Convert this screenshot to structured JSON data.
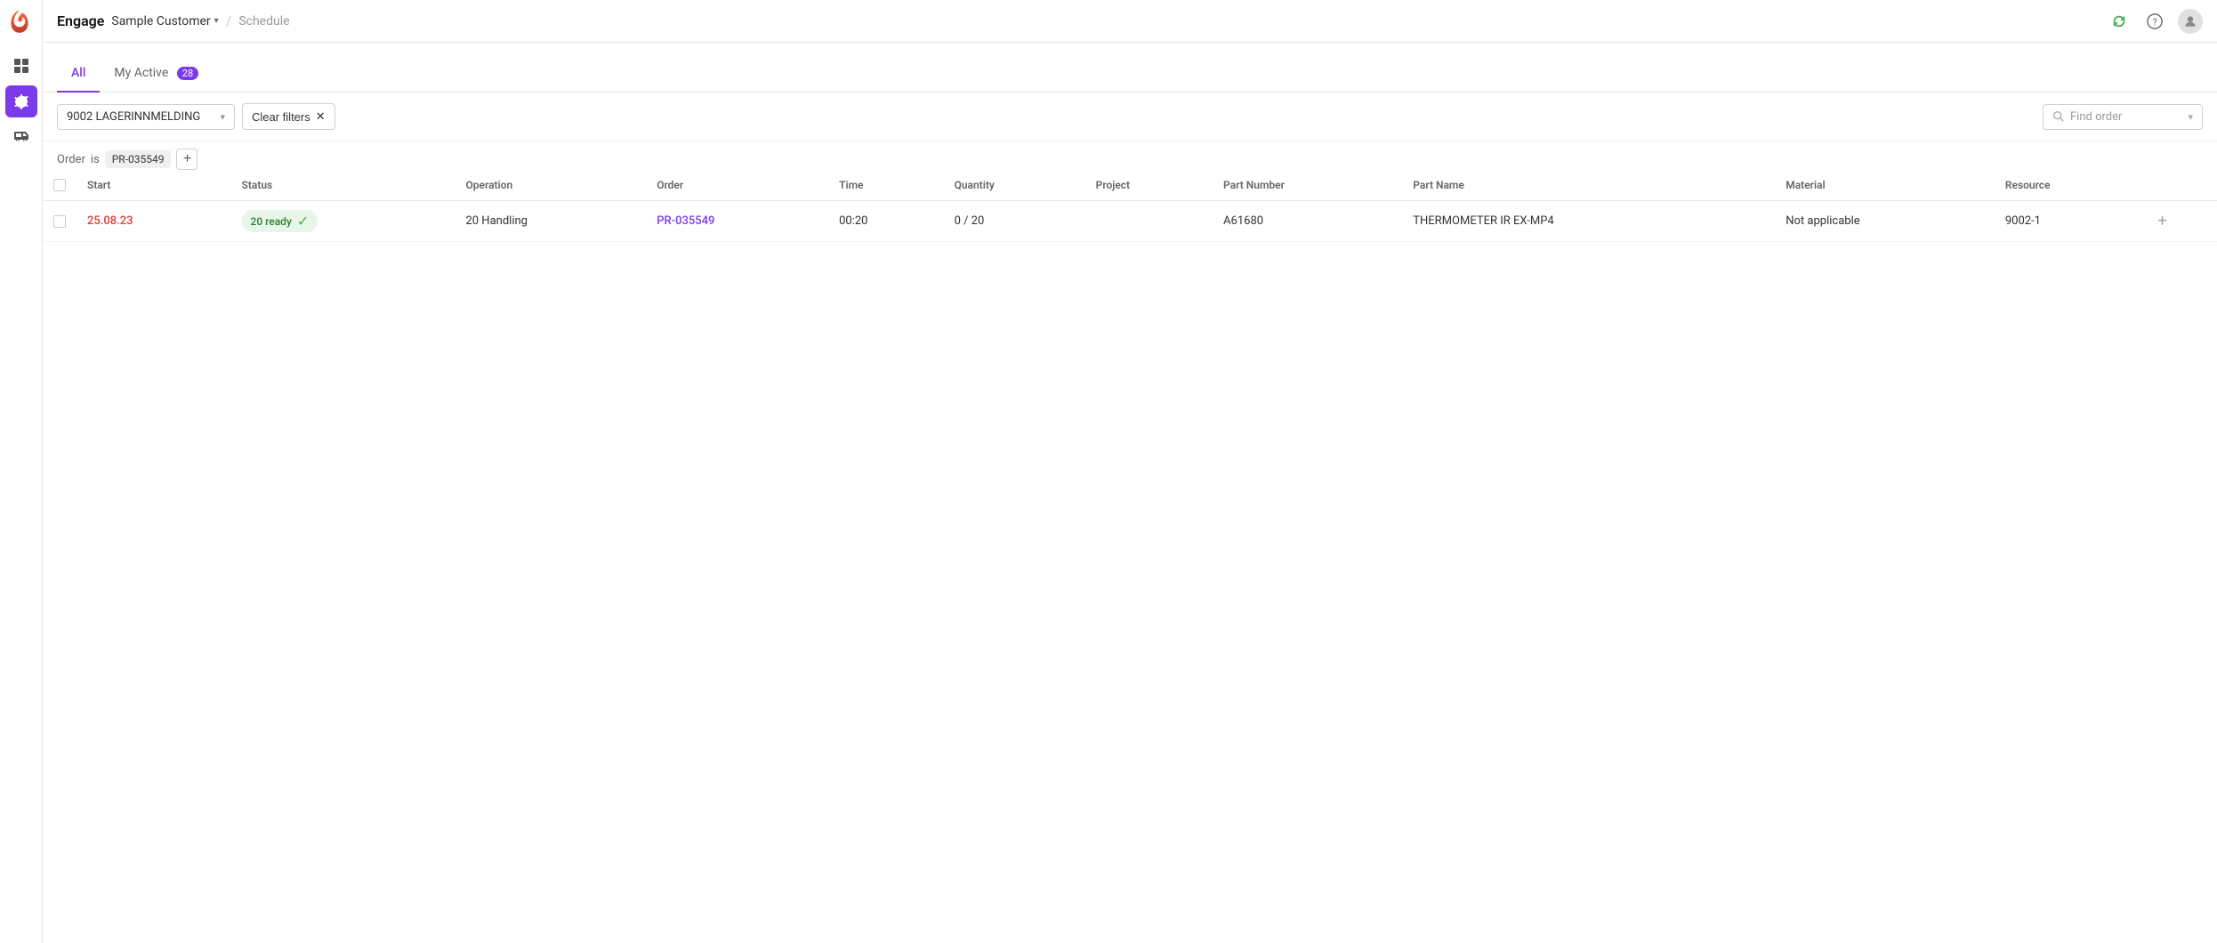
{
  "app": {
    "title": "Engage",
    "logo_alt": "Engage Logo"
  },
  "breadcrumb": {
    "customer": "Sample Customer",
    "separator": "/",
    "page": "Schedule"
  },
  "tabs": [
    {
      "id": "all",
      "label": "All",
      "badge": null,
      "active": true
    },
    {
      "id": "my-active",
      "label": "My Active",
      "badge": "28",
      "active": false
    }
  ],
  "filter": {
    "dropdown_value": "9002 LAGERINNMELDING",
    "clear_label": "Clear filters",
    "find_placeholder": "Find order"
  },
  "order_filter": {
    "label_order": "Order",
    "label_is": "is",
    "value": "PR-035549"
  },
  "table": {
    "columns": [
      {
        "id": "checkbox",
        "label": ""
      },
      {
        "id": "start",
        "label": "Start"
      },
      {
        "id": "status",
        "label": "Status"
      },
      {
        "id": "operation",
        "label": "Operation"
      },
      {
        "id": "order",
        "label": "Order"
      },
      {
        "id": "time",
        "label": "Time"
      },
      {
        "id": "quantity",
        "label": "Quantity"
      },
      {
        "id": "project",
        "label": "Project"
      },
      {
        "id": "part_number",
        "label": "Part Number"
      },
      {
        "id": "part_name",
        "label": "Part Name"
      },
      {
        "id": "material",
        "label": "Material"
      },
      {
        "id": "resource",
        "label": "Resource"
      }
    ],
    "rows": [
      {
        "start": "25.08.23",
        "status": "20 ready",
        "operation": "20 Handling",
        "order": "PR-035549",
        "time": "00:20",
        "quantity": "0 / 20",
        "project": "",
        "part_number": "A61680",
        "part_name": "THERMOMETER IR EX-MP4",
        "material": "Not applicable",
        "resource": "9002-1"
      }
    ]
  },
  "icons": {
    "refresh": "↺",
    "help": "?",
    "grid": "⊞",
    "gear": "⚙",
    "truck": "🚚"
  }
}
